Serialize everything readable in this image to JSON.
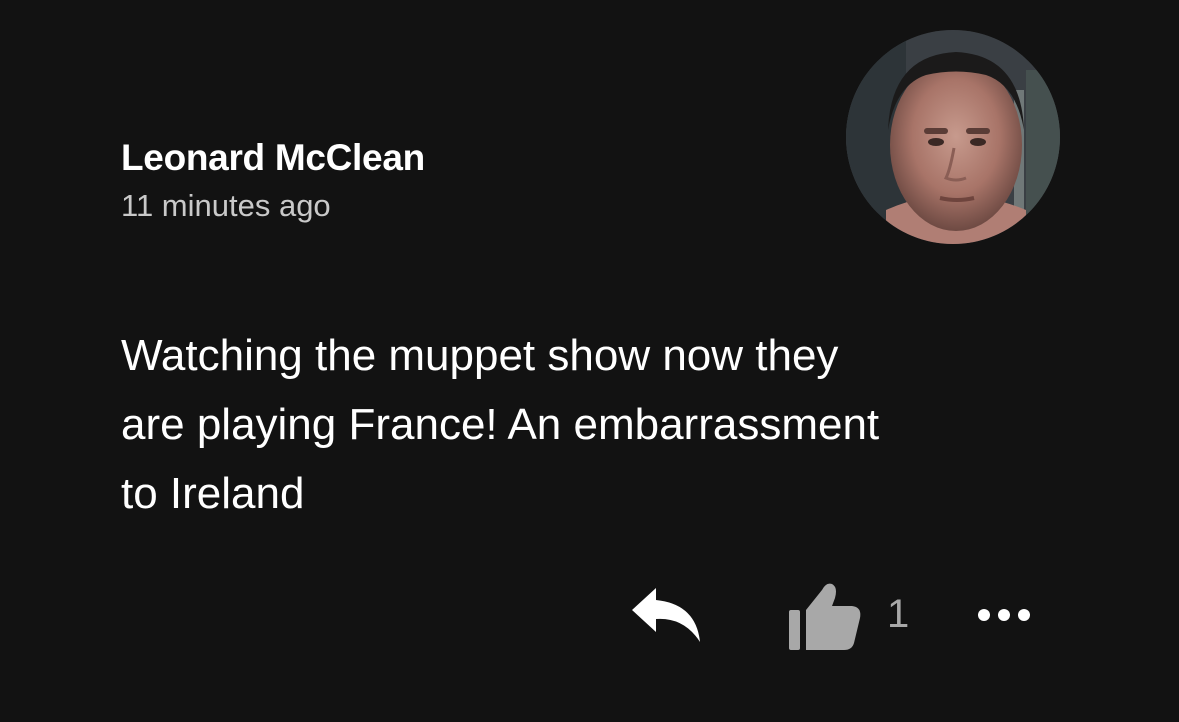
{
  "comment": {
    "author": "Leonard McClean",
    "timestamp": "11 minutes ago",
    "text": "Watching the muppet show now they\nare playing France! An embarrassment\nto Ireland",
    "like_count": "1"
  },
  "icons": {
    "reply": "reply-arrow-icon",
    "like": "thumbs-up-icon",
    "more": "more-horizontal-icon"
  },
  "colors": {
    "background": "#121212",
    "primary_text": "#ffffff",
    "secondary_text": "#c9c9c9",
    "icon_light": "#ffffff",
    "icon_muted": "#a8a8a8"
  }
}
